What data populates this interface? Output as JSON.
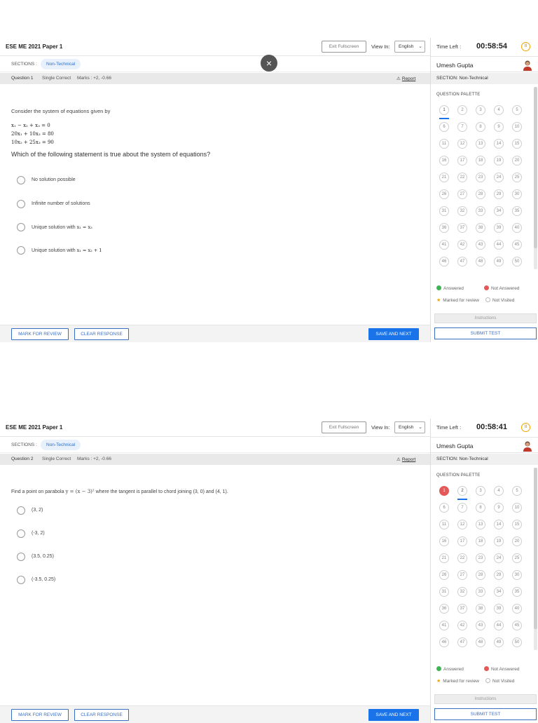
{
  "screens": [
    {
      "exam_title": "ESE ME 2021 Paper 1",
      "exit_fullscreen": "Exit Fullscreen",
      "view_in_label": "View In:",
      "language": "English",
      "sections_label": "SECTIONS :",
      "section_chip": "Non-Technical",
      "close_glyph": "×",
      "question_number": "Question 1",
      "question_type": "Single Correct",
      "marks": "Marks : +2, -0.66",
      "report": "Report",
      "question_intro": "Consider the system of equations given by",
      "equations": [
        "x₁ − x₂ + x₃ = 0",
        "20x₁ + 10x₃ = 80",
        "10x₂ + 25x₃ = 90"
      ],
      "question_text": "Which of the following statement is true about the system of equations?",
      "options": [
        {
          "text": "No solution possible",
          "math": ""
        },
        {
          "text": "Infinite number of solutions",
          "math": ""
        },
        {
          "text": "Unique solution with ",
          "math": "x₁ = x₃"
        },
        {
          "text": "Unique solution with ",
          "math": "x₁ = x₂ + 1"
        }
      ],
      "buttons": {
        "mark": "MARK FOR REVIEW",
        "clear": "CLEAR RESPONSE",
        "save": "SAVE AND NEXT"
      },
      "time_left_label": "Time Left :",
      "time_left": "00:58:54",
      "user_name": "Umesh Gupta",
      "section_name": "SECTION: Non-Technical",
      "palette_label": "QUESTION PALETTE",
      "current_question": 1,
      "not_answered": [],
      "legend": {
        "answered": "Answered",
        "not_answered": "Not Answered",
        "marked": "Marked for review",
        "not_visited": "Not Visited"
      },
      "instructions": "Instructions",
      "submit": "SUBMIT TEST"
    },
    {
      "exam_title": "ESE ME 2021 Paper 1",
      "exit_fullscreen": "Exit Fullscreen",
      "view_in_label": "View In:",
      "language": "English",
      "sections_label": "SECTIONS :",
      "section_chip": "Non-Technical",
      "question_number": "Question 2",
      "question_type": "Single Correct",
      "marks": "Marks : +2, -0.66",
      "report": "Report",
      "question_pre": "Find a point on parabola ",
      "question_math": "y = (x − 3)²",
      "question_post": " where the tangent is parallel to chord joining (3, 0) and (4, 1).",
      "options": [
        {
          "text": "(3, 2)"
        },
        {
          "text": "(-3, 2)"
        },
        {
          "text": "(3.5, 0.25)"
        },
        {
          "text": "(-3.5, 0.25)"
        }
      ],
      "buttons": {
        "mark": "MARK FOR REVIEW",
        "clear": "CLEAR RESPONSE",
        "save": "SAVE AND NEXT"
      },
      "time_left_label": "Time Left :",
      "time_left": "00:58:41",
      "user_name": "Umesh Gupta",
      "section_name": "SECTION: Non-Technical",
      "palette_label": "QUESTION PALETTE",
      "current_question": 2,
      "not_answered": [
        1
      ],
      "legend": {
        "answered": "Answered",
        "not_answered": "Not Answered",
        "marked": "Marked for review",
        "not_visited": "Not Visited"
      },
      "instructions": "Instructions",
      "submit": "SUBMIT TEST"
    }
  ],
  "palette_numbers": [
    1,
    2,
    3,
    4,
    5,
    6,
    7,
    8,
    9,
    10,
    11,
    12,
    13,
    14,
    15,
    16,
    17,
    18,
    19,
    20,
    21,
    22,
    23,
    24,
    25,
    26,
    27,
    28,
    29,
    30,
    31,
    32,
    33,
    34,
    35,
    36,
    37,
    38,
    39,
    40,
    41,
    42,
    43,
    44,
    45,
    46,
    47,
    48,
    49,
    50
  ],
  "colors": {
    "accent": "#1a73e8",
    "not_answered": "#e45858",
    "answered": "#3db552",
    "timer_icon": "#f0a400"
  }
}
